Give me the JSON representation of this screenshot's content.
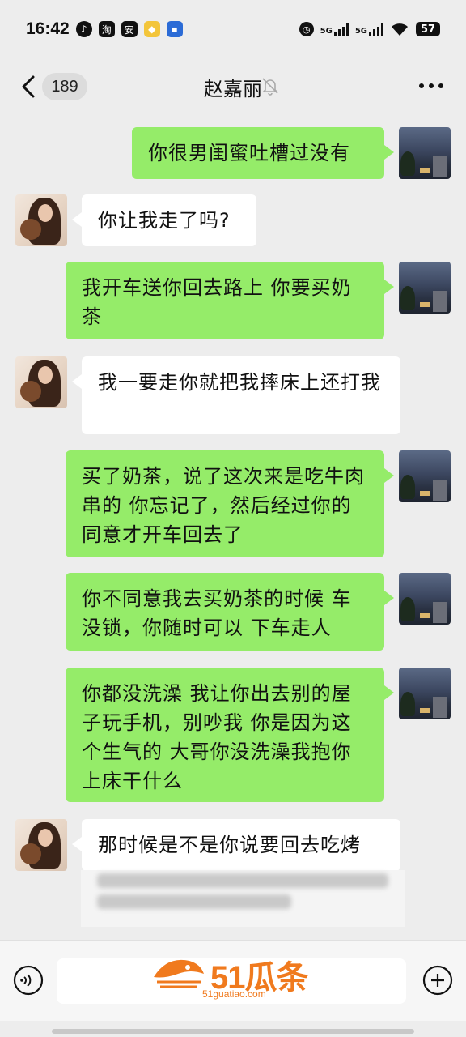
{
  "status_bar": {
    "time": "16:42",
    "app_icons": [
      "tiktok-icon",
      "taobao-icon",
      "security-icon",
      "shield-app-icon",
      "message-app-icon"
    ],
    "app_icon_labels": [
      "",
      "淘",
      "安",
      "",
      ""
    ],
    "network_1": "5G",
    "network_2": "5G",
    "battery": "57"
  },
  "nav": {
    "unread_count": "189",
    "title": "赵嘉丽"
  },
  "messages": [
    {
      "sender": "me",
      "text": "你很男闺蜜吐槽过没有"
    },
    {
      "sender": "her",
      "text": "你让我走了吗?"
    },
    {
      "sender": "me",
      "text": "我开车送你回去路上 你要买奶茶"
    },
    {
      "sender": "her",
      "text": "我一要走你就把我摔床上还打我"
    },
    {
      "sender": "me",
      "text": "买了奶茶，说了这次来是吃牛肉串的  你忘记了，然后经过你的同意才开车回去了"
    },
    {
      "sender": "me",
      "text": "你不同意我去买奶茶的时候 车没锁，你随时可以 下车走人"
    },
    {
      "sender": "me",
      "text": "你都没洗澡  我让你出去别的屋子玩手机，别吵我  你是因为这个生气的  大哥你没洗澡我抱你上床干什么"
    },
    {
      "sender": "her",
      "text": "那时候是不是你说要回去吃烤"
    }
  ],
  "watermark": {
    "text": "51瓜条",
    "url": "51guatiao.com",
    "color": "#f07a1e"
  },
  "colors": {
    "background": "#ededed",
    "my_bubble": "#95ec69",
    "her_bubble": "#ffffff"
  }
}
